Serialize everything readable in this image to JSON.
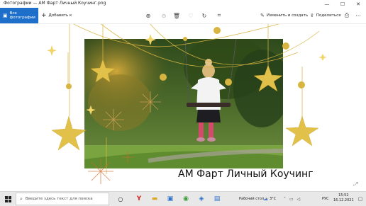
{
  "window": {
    "title": "Фотографии — АМ Фарт Личный Коучинг.png",
    "min_icon": "minimize-icon",
    "max_icon": "maximize-icon",
    "close_icon": "close-icon"
  },
  "toolbar": {
    "all_photos_label": "Все фотографии",
    "add_label": "Добавить к",
    "edit_label": "Изменить и создать",
    "share_label": "Поделиться",
    "icons": [
      "zoom-in-icon",
      "delete-icon",
      "favorite-icon",
      "rotate-icon",
      "crop-icon",
      "print-icon",
      "more-icon"
    ]
  },
  "image": {
    "caption": "АМ Фарт Личный Коучинг",
    "colors": {
      "gold": "#d8b440",
      "gold_light": "#f3dc7a",
      "forest": "#3f5a22",
      "grass": "#6e9a3c"
    }
  },
  "taskbar": {
    "search_placeholder": "Введите здесь текст для поиска",
    "desktop_label": "Рабочий стол",
    "weather": "3°C",
    "language": "РУС",
    "time": "15:52",
    "date": "16.12.2021"
  }
}
